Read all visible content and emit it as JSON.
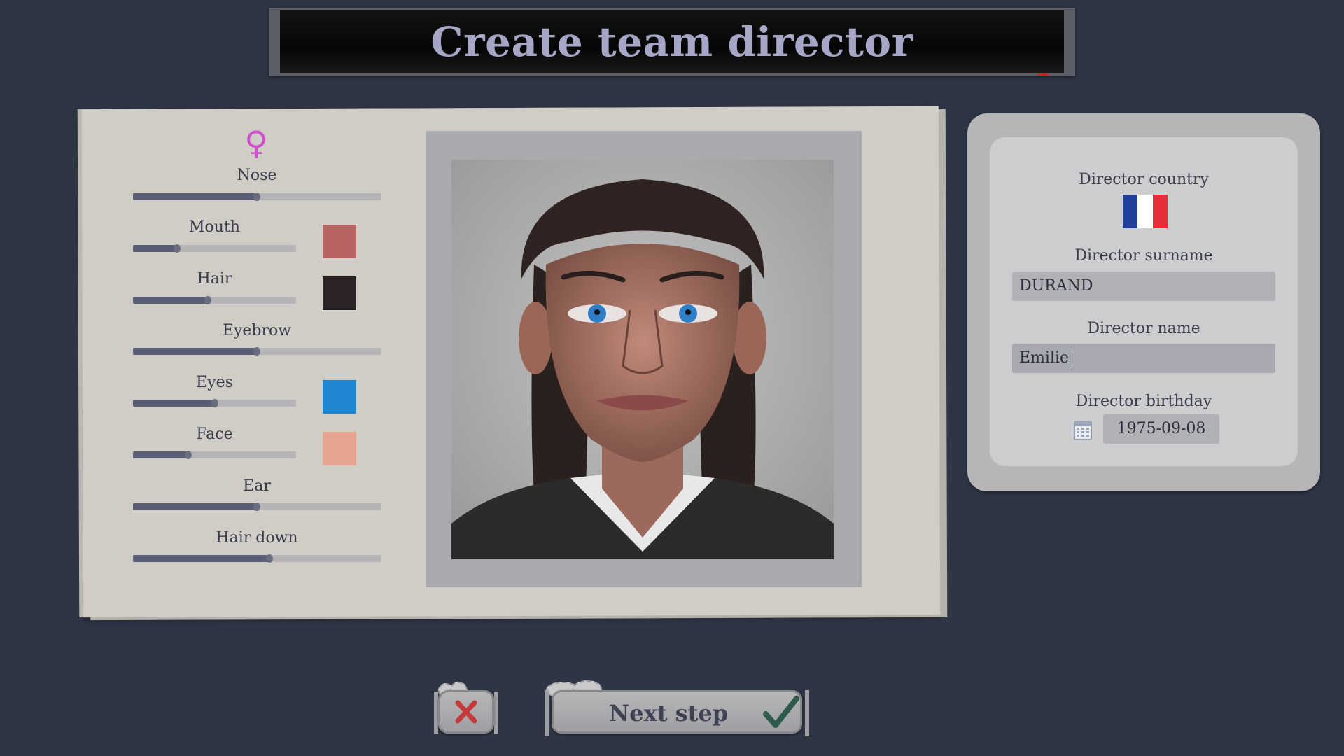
{
  "header": {
    "title": "Create team director"
  },
  "appearance": {
    "gender_icon": "female-symbol-icon",
    "sliders": [
      {
        "key": "nose",
        "label": "Nose",
        "value": 0.5,
        "swatch": null
      },
      {
        "key": "mouth",
        "label": "Mouth",
        "value": 0.27,
        "swatch": "#b86464"
      },
      {
        "key": "hair",
        "label": "Hair",
        "value": 0.46,
        "swatch": "#2c2424"
      },
      {
        "key": "eyebrow",
        "label": "Eyebrow",
        "value": 0.5,
        "swatch": null
      },
      {
        "key": "eyes",
        "label": "Eyes",
        "value": 0.5,
        "swatch": "#1f86d2"
      },
      {
        "key": "face",
        "label": "Face",
        "value": 0.34,
        "swatch": "#e6a48f"
      },
      {
        "key": "ear",
        "label": "Ear",
        "value": 0.5,
        "swatch": null
      },
      {
        "key": "hair_down",
        "label": "Hair down",
        "value": 0.55,
        "swatch": null
      }
    ]
  },
  "director": {
    "country_label": "Director country",
    "country_flag": "france-flag-icon",
    "surname_label": "Director surname",
    "surname_value": "DURAND",
    "name_label": "Director name",
    "name_value": "Emilie",
    "birthday_label": "Director birthday",
    "birthday_value": "1975-09-08",
    "calendar_icon": "calendar-icon"
  },
  "buttons": {
    "cancel_icon": "close-x-icon",
    "next_label": "Next step",
    "next_icon": "checkmark-icon"
  },
  "colors": {
    "background": "#2e3544",
    "title_text": "#a6a6c6",
    "slider_fill": "#5a5e75",
    "female_icon": "#d04ed0",
    "flag_blue": "#1f3f9a",
    "flag_white": "#ffffff",
    "flag_red": "#e52e3a",
    "cancel_x": "#c43a3a",
    "checkmark": "#2e5a4a"
  }
}
